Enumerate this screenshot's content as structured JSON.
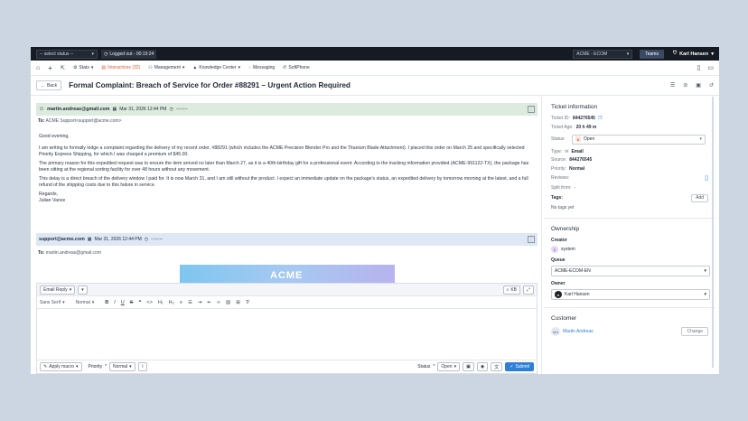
{
  "topbar": {
    "status_select": "-- select status --",
    "logged_status": "Logged out - 00:15:24",
    "workspace": "ACME - ECOM",
    "teams_label": "Teams",
    "user_name": "Karl Hansen"
  },
  "nav": {
    "stats": "Stats",
    "interactions": "Interactions (32)",
    "management": "Management",
    "knowledge": "Knowledge Center",
    "messaging": "Messaging",
    "softphone": "SoftPhone"
  },
  "header": {
    "back_label": "Back",
    "title": "Formal Complaint: Breach of Service for Order #88291 – Urgent Action Required"
  },
  "message1": {
    "from": "martin.andreas@gmail.com",
    "date": "Mar 31, 2026 12:44 PM",
    "dashes": "--:--:--",
    "to_label": "To:",
    "to": "ACME Support<support@acme.com>",
    "greeting": "Good evening,",
    "p1": "I am writing to formally lodge a complaint regarding the delivery of my recent order, #88291 (which includes the ACME Precision Blender Pro and the Titanium Blade Attachment). I placed this order on March 25 and specifically selected Priority Express Shipping, for which I was charged a premium of $45.00.",
    "p2": "The primary reason for this expedited request was to ensure the item arrived no later than March 27, as it is a 40th-birthday gift for a professional event. According to the tracking information provided (ACME-991122-TX), the package has been sitting at the regional sorting facility for over 48 hours without any movement.",
    "p3": "This delay is a direct breach of the delivery window I paid for. It is now March 31, and I am still without the product. I expect an immediate update on the package's status, an expedited delivery by tomorrow morning at the latest, and a full refund of the shipping costs due to this failure in service.",
    "sign1": "Regards,",
    "sign2": "Julian Vance"
  },
  "message2": {
    "from": "support@acme.com",
    "date": "Mar 31, 2026 12:44 PM",
    "dashes": "--:--:--",
    "to_label": "To:",
    "to": "martin.andreas@gmail.com"
  },
  "reply": {
    "mode": "Email Reply",
    "kb": "KB",
    "font": "Sans Serif",
    "size": "Normal",
    "apply_macro": "Apply macro",
    "priority_label": "Priority",
    "priority_value": "Normal",
    "status_label": "Status",
    "status_value": "Open",
    "submit": "Submit"
  },
  "ticket": {
    "heading": "Ticket information",
    "id_label": "Ticket ID:",
    "id": "844276545",
    "age_label": "Ticket Age:",
    "age": "20 h 49 m",
    "status_label": "Status:",
    "status": "Open",
    "type_label": "Type:",
    "type": "Email",
    "source_label": "Source:",
    "source": "844276545",
    "priority_label": "Priority:",
    "priority": "Normal",
    "reviews_label": "Reviews:",
    "split_label": "Split from:",
    "split": "-",
    "tags_label": "Tags:",
    "add_label": "Add",
    "no_tags": "No tags yet"
  },
  "ownership": {
    "heading": "Ownership",
    "creator_label": "Creator",
    "creator": "system",
    "creator_initial": "S",
    "queue_label": "Queue",
    "queue": "ACME-ECOM-EN",
    "owner_label": "Owner",
    "owner": "Karl Hansen"
  },
  "customer": {
    "heading": "Customer",
    "initials": "MA",
    "name": "Martin Andreas",
    "change_label": "Change"
  }
}
